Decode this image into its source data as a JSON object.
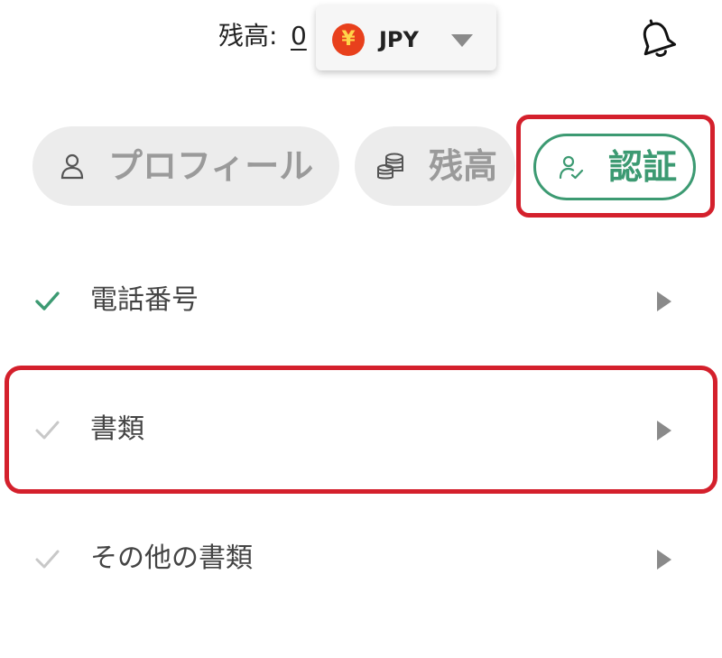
{
  "header": {
    "balance_label": "残高:",
    "balance_value": "0",
    "currency_symbol": "¥",
    "currency_code": "JPY",
    "icons": {
      "currency": "yen-coin-icon",
      "dropdown": "caret-down-icon",
      "notifications": "bell-icon"
    }
  },
  "tabs": [
    {
      "label": "プロフィール",
      "icon": "user-icon",
      "active": false
    },
    {
      "label": "残高",
      "icon": "coins-icon",
      "active": false
    },
    {
      "label": "認証",
      "icon": "user-check-icon",
      "active": true
    }
  ],
  "verification_items": [
    {
      "label": "電話番号",
      "completed": true
    },
    {
      "label": "書類",
      "completed": false
    },
    {
      "label": "その他の書類",
      "completed": false
    }
  ],
  "colors": {
    "accent_green": "#3c9a72",
    "highlight_red": "#d4202c",
    "tab_inactive_bg": "#ececec",
    "inactive_text": "#9a9a9a",
    "coin": "#e8401c"
  }
}
